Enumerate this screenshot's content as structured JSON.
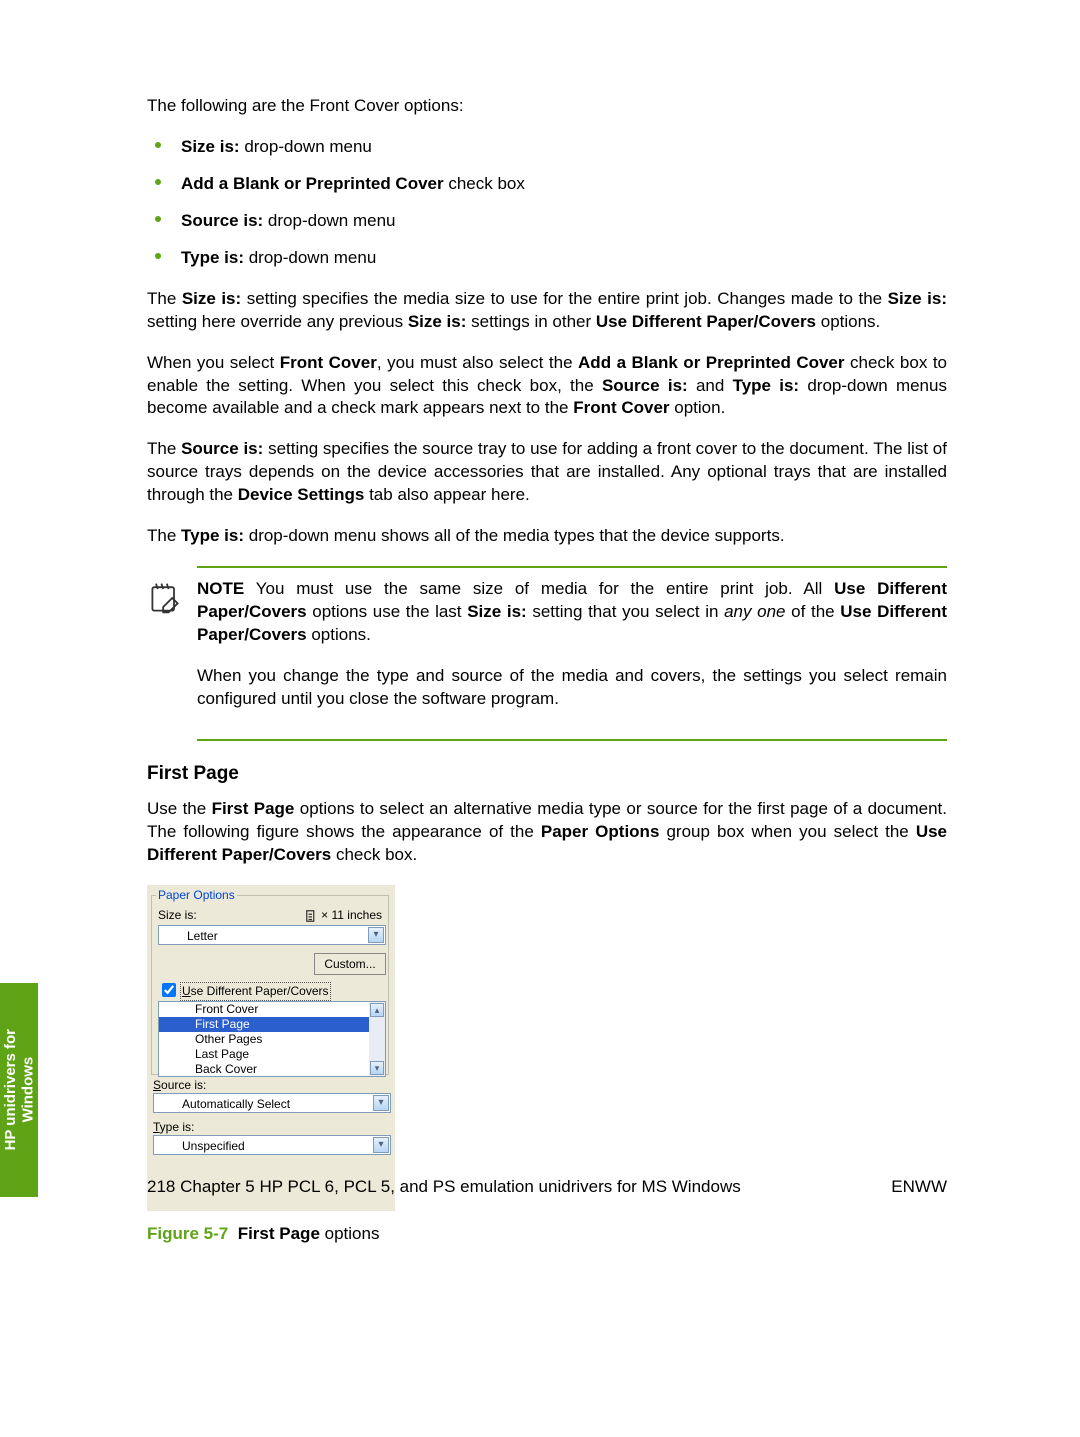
{
  "intro": "The following are the Front Cover options:",
  "bullets": [
    {
      "bold": "Size is:",
      "rest": " drop-down menu"
    },
    {
      "bold": "Add a Blank or Preprinted Cover",
      "rest": " check box"
    },
    {
      "bold": "Source is:",
      "rest": " drop-down menu"
    },
    {
      "bold": "Type is:",
      "rest": " drop-down menu"
    }
  ],
  "para_size": {
    "p1a": "The ",
    "p1b": "Size is:",
    "p1c": " setting specifies the media size to use for the entire print job. Changes made to the ",
    "p1d": "Size is:",
    "p1e": " setting here override any previous ",
    "p1f": "Size is:",
    "p1g": " settings in other ",
    "p1h": "Use Different Paper/Covers",
    "p1i": " options."
  },
  "para_front": {
    "a": "When you select ",
    "b": "Front Cover",
    "c": ", you must also select the ",
    "d": "Add a Blank or Preprinted Cover",
    "e": " check box to enable the setting. When you select this check box, the ",
    "f": "Source is:",
    "g": " and ",
    "h": "Type is:",
    "i": " drop-down menus become available and a check mark appears next to the ",
    "j": "Front Cover",
    "k": " option."
  },
  "para_source": {
    "a": "The ",
    "b": "Source is:",
    "c": " setting specifies the source tray to use for adding a front cover to the document. The list of source trays depends on the device accessories that are installed. Any optional trays that are installed through the ",
    "d": "Device Settings",
    "e": " tab also appear here."
  },
  "para_type": {
    "a": "The ",
    "b": "Type is:",
    "c": " drop-down menu shows all of the media types that the device supports."
  },
  "note": {
    "label": "NOTE",
    "p1a": "   You must use the same size of media for the entire print job. All ",
    "p1b": "Use Different Paper/Covers",
    "p1c": " options use the last ",
    "p1d": "Size is:",
    "p1e": " setting that you select in ",
    "p1it": "any one",
    "p1f": " of the ",
    "p1g": "Use Different Paper/Covers",
    "p1h": " options.",
    "p2": "When you change the type and source of the media and covers, the settings you select remain configured until you close the software program."
  },
  "first_page": {
    "heading": "First Page",
    "para": {
      "a": "Use the ",
      "b": "First Page",
      "c": " options to select an alternative media type or source for the first page of a document. The following figure shows the appearance of the ",
      "d": "Paper Options",
      "e": " group box when you select the ",
      "f": "Use Different Paper/Covers",
      "g": " check box."
    }
  },
  "figure": {
    "legend": "Paper Options",
    "size_label": "Size is:",
    "dims": "× 11 inches",
    "size_value": "Letter",
    "custom": "Custom...",
    "use_diff": "Use Different Paper/Covers",
    "list": [
      "Front Cover",
      "First Page",
      "Other Pages",
      "Last Page",
      "Back Cover"
    ],
    "selected_index": 1,
    "source_label": "Source is:",
    "source_value": "Automatically Select",
    "type_label": "Type is:",
    "type_value": "Unspecified",
    "caption_num": "Figure 5-7",
    "caption_bold": "First Page",
    "caption_rest": " options"
  },
  "footer": {
    "page": "218",
    "chapter": "   Chapter 5   HP PCL 6, PCL 5, and PS emulation unidrivers for MS Windows",
    "right": "ENWW"
  },
  "side_tab": "HP unidrivers for\nWindows"
}
